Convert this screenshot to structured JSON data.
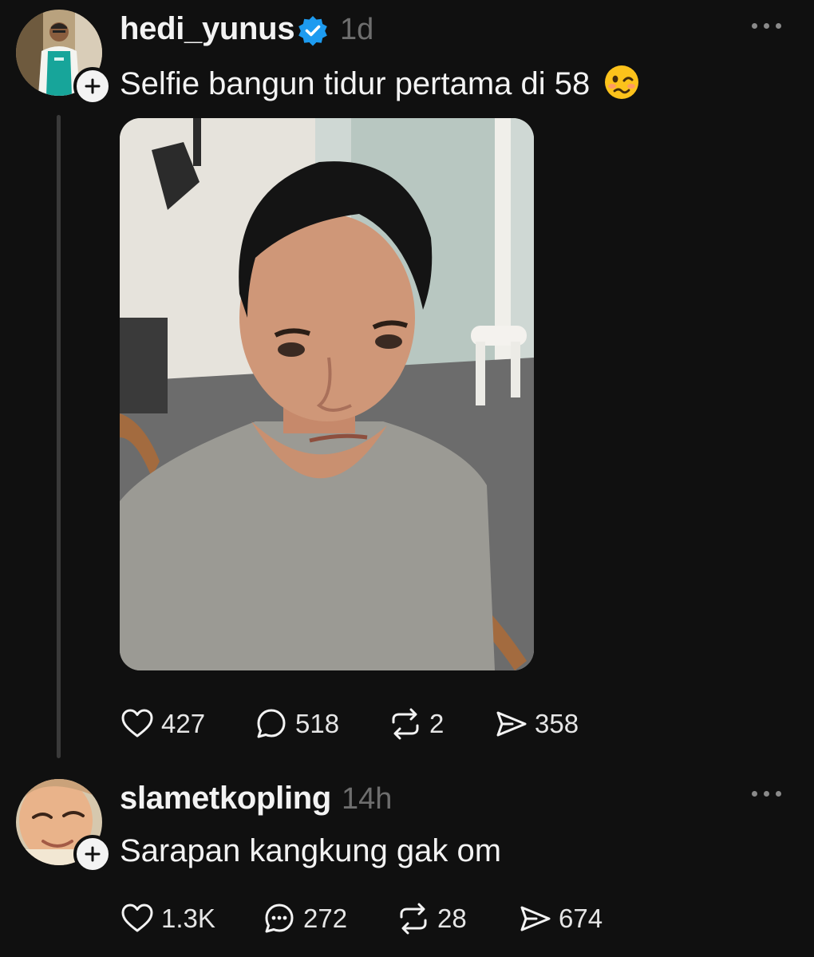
{
  "posts": [
    {
      "username": "hedi_yunus",
      "verified": true,
      "time": "1d",
      "text": "Selfie bangun tidur pertama di 58",
      "emoji": "woozy-face",
      "actions": {
        "likes": "427",
        "replies": "518",
        "reposts": "2",
        "shares": "358"
      }
    },
    {
      "username": "slametkopling",
      "verified": false,
      "time": "14h",
      "text": "Sarapan kangkung gak om",
      "actions": {
        "likes": "1.3K",
        "replies": "272",
        "reposts": "28",
        "shares": "674"
      }
    }
  ],
  "icons": {
    "verified": "verified-badge-icon",
    "follow": "plus-icon",
    "more": "more-options-icon",
    "like": "heart-icon",
    "reply": "comment-icon",
    "repost": "repost-icon",
    "share": "share-icon"
  },
  "colors": {
    "background": "#101010",
    "verified": "#1d9bf0",
    "muted": "#6e6e6e"
  }
}
